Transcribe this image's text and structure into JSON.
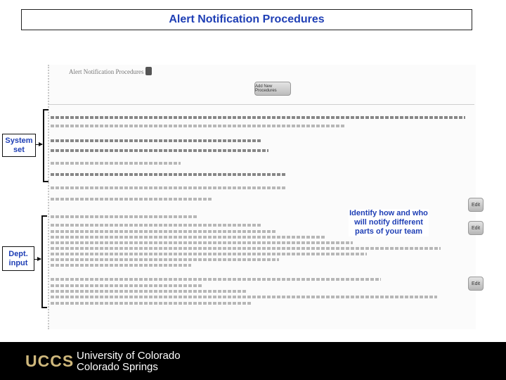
{
  "title": "Alert Notification Procedures",
  "screenshot": {
    "page_title": "Alert Notification Procedures",
    "button_label": "Add New Procedures"
  },
  "annotations": {
    "system_set": "System set",
    "dept_input": "Dept. input",
    "callout": "Identify how and who will notify different parts of your team"
  },
  "edit_buttons": [
    "Edit",
    "Edit",
    "Edit"
  ],
  "footer": {
    "logo": "UCCS",
    "university_line1": "University of Colorado",
    "university_line2": "Colorado Springs"
  },
  "colors": {
    "accent": "#1f3fb5",
    "footer_bg": "#000000",
    "logo_gold": "#cfb87c"
  }
}
